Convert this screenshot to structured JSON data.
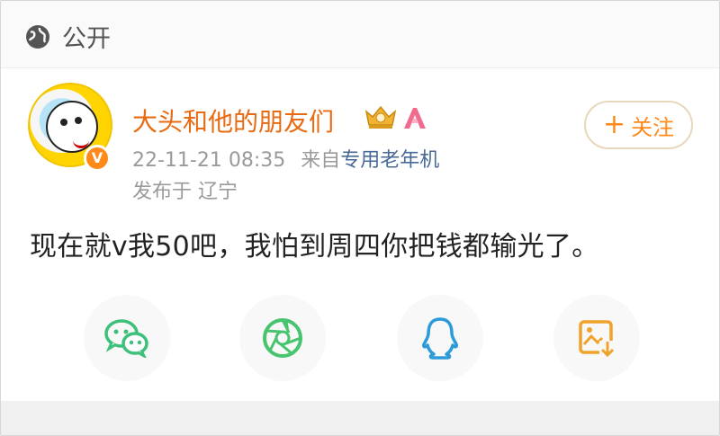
{
  "header": {
    "visibility_label": "公开",
    "visibility_icon": "globe-icon"
  },
  "post": {
    "username": "大头和他的朋友们",
    "verified_badge": "V",
    "timestamp": "22-11-21 08:35",
    "source_prefix": "来自",
    "source": "专用老年机",
    "location": "发布于 辽宁",
    "content": "现在就v我50吧，我怕到周四你把钱都输光了。",
    "follow_label": "关注",
    "follow_plus": "+"
  },
  "share": [
    {
      "icon": "wechat-icon"
    },
    {
      "icon": "moments-icon"
    },
    {
      "icon": "qq-icon"
    },
    {
      "icon": "save-image-icon"
    }
  ],
  "colors": {
    "username": "#e86a13",
    "accent_orange": "#ff8a1a",
    "source_link": "#486a96",
    "meta_gray": "#9a9a9a",
    "wechat_green": "#3cc07a",
    "moments_green": "#48c46f",
    "qq_blue": "#2d9bd8",
    "save_orange": "#f0a22a"
  }
}
